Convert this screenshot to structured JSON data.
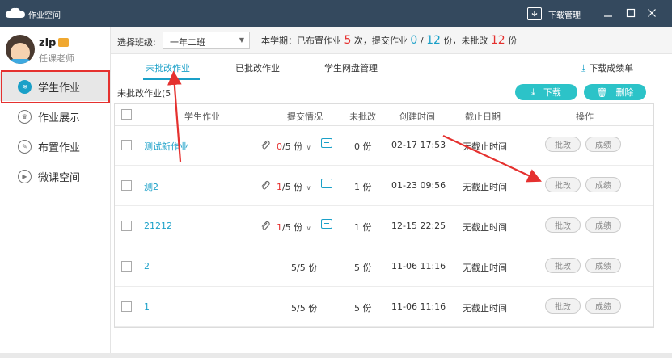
{
  "window": {
    "title": "作业空间",
    "download_manager": "下载管理"
  },
  "user": {
    "name": "zlp",
    "role": "任课老师"
  },
  "sidebar": {
    "items": [
      {
        "label": "学生作业",
        "icon": "layers-icon"
      },
      {
        "label": "作业展示",
        "icon": "trophy-icon"
      },
      {
        "label": "布置作业",
        "icon": "edit-icon"
      },
      {
        "label": "微课空间",
        "icon": "play-icon"
      }
    ]
  },
  "topbar": {
    "class_label": "选择班级:",
    "class_value": "一年二班",
    "summary_prefix": "本学期：已布置作业",
    "assigned_count": "5",
    "summary_mid1": "次，提交作业",
    "submitted_count": "0",
    "submitted_sep": "/",
    "submitted_total": "12",
    "summary_mid2": "份，未批改",
    "unreviewed_count": "12",
    "summary_suffix": "份"
  },
  "tabs": [
    "未批改作业",
    "已批改作业",
    "学生网盘管理"
  ],
  "download_grades": "下载成绩单",
  "section_label": "未批改作业(5",
  "actions": {
    "download": "下载",
    "delete": "删除"
  },
  "table": {
    "headers": [
      "学生作业",
      "提交情况",
      "未批改",
      "创建时间",
      "截止日期",
      "操作"
    ],
    "rows": [
      {
        "title": "测试新作业",
        "submitted": "0",
        "submitted_rest": "/5 份",
        "unreviewed": "0 份",
        "created": "02-17 17:53",
        "deadline": "无截止时间",
        "review": "批改",
        "grades": "成绩"
      },
      {
        "title": "测2",
        "submitted": "1",
        "submitted_rest": "/5 份",
        "unreviewed": "1 份",
        "created": "01-23 09:56",
        "deadline": "无截止时间",
        "review": "批改",
        "grades": "成绩"
      },
      {
        "title": "21212",
        "submitted": "1",
        "submitted_rest": "/5 份",
        "unreviewed": "1 份",
        "created": "12-15 22:25",
        "deadline": "无截止时间",
        "review": "批改",
        "grades": "成绩"
      },
      {
        "title": "2",
        "submitted": "5",
        "submitted_rest": "/5 份",
        "unreviewed": "5 份",
        "created": "11-06 11:16",
        "deadline": "无截止时间",
        "review": "批改",
        "grades": "成绩"
      },
      {
        "title": "1",
        "submitted": "5",
        "submitted_rest": "/5 份",
        "unreviewed": "5 份",
        "created": "11-06 11:16",
        "deadline": "无截止时间",
        "review": "批改",
        "grades": "成绩"
      }
    ]
  },
  "colors": {
    "accent": "#1aa0c8",
    "titlebar": "#34495e",
    "highlight": "#e5312f",
    "button": "#2cc3c8"
  }
}
